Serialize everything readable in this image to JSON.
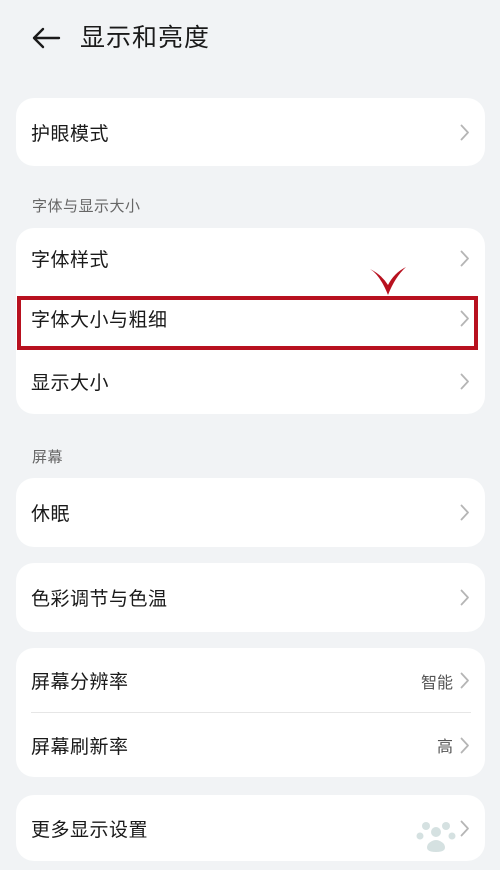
{
  "header": {
    "title": "显示和亮度"
  },
  "groups": {
    "eye": {
      "item": "护眼模式"
    },
    "font": {
      "section": "字体与显示大小",
      "items": [
        "字体样式",
        "字体大小与粗细",
        "显示大小"
      ]
    },
    "screen": {
      "section": "屏幕",
      "sleep": "休眠",
      "color": "色彩调节与色温",
      "resolution": {
        "label": "屏幕分辨率",
        "value": "智能"
      },
      "refresh": {
        "label": "屏幕刷新率",
        "value": "高"
      }
    },
    "more": {
      "item": "更多显示设置"
    }
  },
  "colors": {
    "background": "#f1f3f5",
    "card": "#ffffff",
    "highlight": "#b8111f",
    "chevron": "#b5b5b5"
  }
}
